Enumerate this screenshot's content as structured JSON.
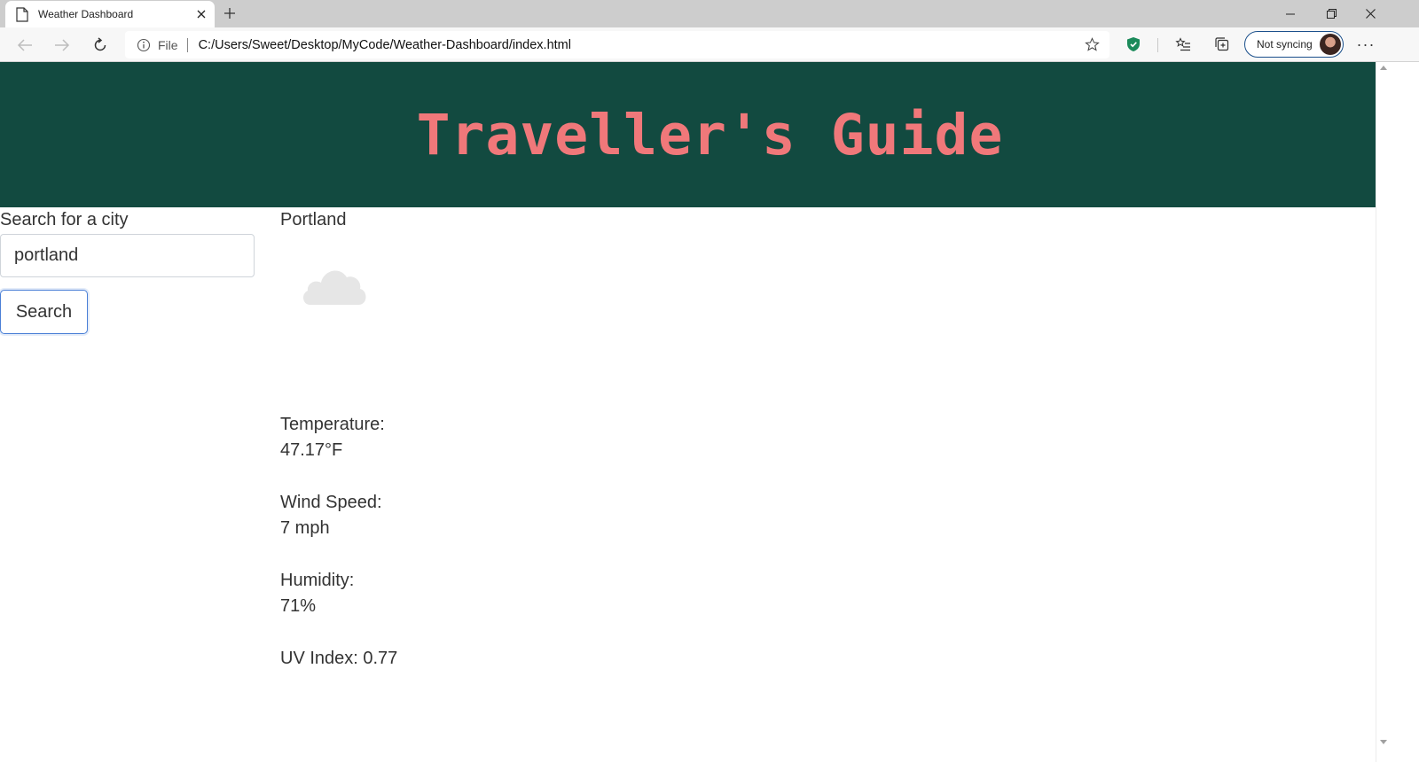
{
  "browser": {
    "tab_title": "Weather Dashboard",
    "file_label": "File",
    "url": "C:/Users/Sweet/Desktop/MyCode/Weather-Dashboard/index.html",
    "profile_label": "Not syncing"
  },
  "page": {
    "header_title": "Traveller's Guide",
    "search": {
      "label": "Search for a city",
      "value": "portland",
      "button_label": "Search"
    },
    "weather": {
      "city": "Portland",
      "icon": "cloud-icon",
      "temperature_label": "Temperature:",
      "temperature_value": "47.17°F",
      "wind_label": "Wind Speed:",
      "wind_value": "7 mph",
      "humidity_label": "Humidity:",
      "humidity_value": "71%",
      "uv_text": "UV Index: 0.77"
    }
  },
  "colors": {
    "header_bg": "#124a40",
    "header_text": "#f0787a",
    "focus_ring": "#4a7fd6"
  }
}
